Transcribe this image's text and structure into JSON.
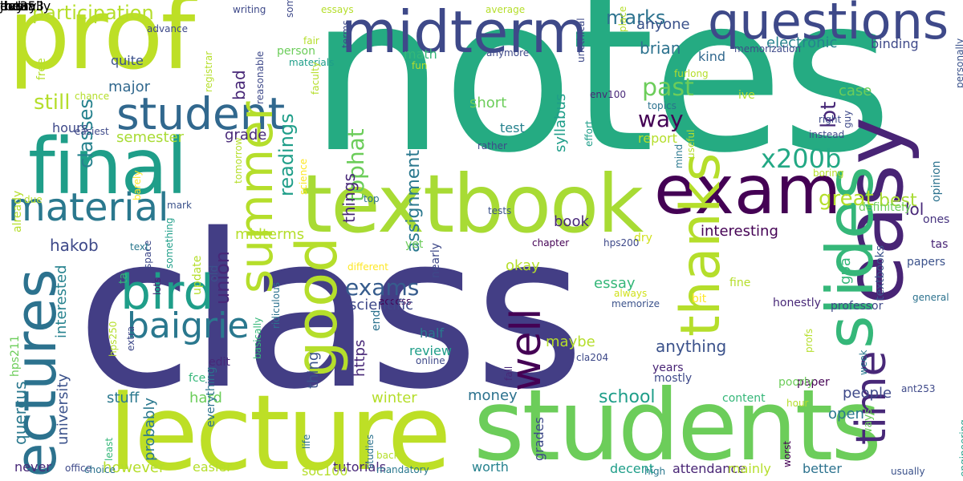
{
  "words": [
    {
      "text": "class",
      "rotated": false
    },
    {
      "text": "notes",
      "rotated": false
    },
    {
      "text": "prof",
      "rotated": false
    },
    {
      "text": "lecture",
      "rotated": false
    },
    {
      "text": "students",
      "rotated": false
    },
    {
      "text": "midterm",
      "rotated": false
    },
    {
      "text": "questions",
      "rotated": false
    },
    {
      "text": "final",
      "rotated": false
    },
    {
      "text": "textbook",
      "rotated": false
    },
    {
      "text": "exam",
      "rotated": false
    },
    {
      "text": "easy",
      "rotated": true
    },
    {
      "text": "slides",
      "rotated": true
    },
    {
      "text": "material",
      "rotated": false
    },
    {
      "text": "student",
      "rotated": false
    },
    {
      "text": "lectures",
      "rotated": true
    },
    {
      "text": "bird",
      "rotated": false
    },
    {
      "text": "good",
      "rotated": true
    },
    {
      "text": "thanks",
      "rotated": true
    },
    {
      "text": "well",
      "rotated": true
    },
    {
      "text": "summer",
      "rotated": true
    },
    {
      "text": "time",
      "rotated": true
    },
    {
      "text": "baigrie",
      "rotated": false
    },
    {
      "text": "exams",
      "rotated": false
    },
    {
      "text": "x200b",
      "rotated": false
    },
    {
      "text": "past",
      "rotated": false
    },
    {
      "text": "way",
      "rotated": false
    },
    {
      "text": "marks",
      "rotated": false
    },
    {
      "text": "great",
      "rotated": false
    },
    {
      "text": "best",
      "rotated": false
    },
    {
      "text": "lol",
      "rotated": false
    },
    {
      "text": "school",
      "rotated": false
    },
    {
      "text": "union",
      "rotated": true
    },
    {
      "text": "quercus",
      "rotated": true
    },
    {
      "text": "participation",
      "rotated": false
    },
    {
      "text": "anyone",
      "rotated": false
    },
    {
      "text": "brian",
      "rotated": false
    },
    {
      "text": "electronic",
      "rotated": false
    },
    {
      "text": "lot",
      "rotated": true
    },
    {
      "text": "binding",
      "rotated": false
    },
    {
      "text": "case",
      "rotated": false
    },
    {
      "text": "classes",
      "rotated": true
    },
    {
      "text": "still",
      "rotated": false
    },
    {
      "text": "quite",
      "rotated": false
    },
    {
      "text": "major",
      "rotated": false
    },
    {
      "text": "semester",
      "rotated": false
    },
    {
      "text": "hours",
      "rotated": false
    },
    {
      "text": "grade",
      "rotated": false
    },
    {
      "text": "readings",
      "rotated": true
    },
    {
      "text": "tophat",
      "rotated": true
    },
    {
      "text": "assignment",
      "rotated": true
    },
    {
      "text": "short",
      "rotated": false
    },
    {
      "text": "test",
      "rotated": false
    },
    {
      "text": "syllabus",
      "rotated": true
    },
    {
      "text": "book",
      "rotated": false
    },
    {
      "text": "report",
      "rotated": false
    },
    {
      "text": "kind",
      "rotated": false
    },
    {
      "text": "personally",
      "rotated": true
    },
    {
      "text": "opinion",
      "rotated": true
    },
    {
      "text": "definitely",
      "rotated": false
    },
    {
      "text": "ones",
      "rotated": false
    },
    {
      "text": "tas",
      "rotated": false
    },
    {
      "text": "papers",
      "rotated": false
    },
    {
      "text": "gpa",
      "rotated": true
    },
    {
      "text": "interesting",
      "rotated": false
    },
    {
      "text": "anything",
      "rotated": false
    },
    {
      "text": "people",
      "rotated": false
    },
    {
      "text": "open",
      "rotated": false
    },
    {
      "text": "ways",
      "rotated": true
    },
    {
      "text": "usually",
      "rotated": false
    },
    {
      "text": "worst",
      "rotated": true
    },
    {
      "text": "week",
      "rotated": true
    },
    {
      "text": "general",
      "rotated": false
    },
    {
      "text": "textbooks",
      "rotated": true
    },
    {
      "text": "engineering",
      "rotated": true
    },
    {
      "text": "ant253",
      "rotated": false
    },
    {
      "text": "dry",
      "rotated": false
    },
    {
      "text": "professor",
      "rotated": false
    },
    {
      "text": "fine",
      "rotated": false
    },
    {
      "text": "honestly",
      "rotated": false
    },
    {
      "text": "bit",
      "rotated": false
    },
    {
      "text": "paper",
      "rotated": false
    },
    {
      "text": "hour",
      "rotated": false
    },
    {
      "text": "content",
      "rotated": false
    },
    {
      "text": "mostly",
      "rotated": false
    },
    {
      "text": "high",
      "rotated": false
    },
    {
      "text": "attendance",
      "rotated": false
    },
    {
      "text": "better",
      "rotated": false
    },
    {
      "text": "mainly",
      "rotated": false
    },
    {
      "text": "decent",
      "rotated": false
    },
    {
      "text": "years",
      "rotated": false
    },
    {
      "text": "poorly",
      "rotated": false
    },
    {
      "text": "cla204",
      "rotated": false
    },
    {
      "text": "memorize",
      "rotated": false
    },
    {
      "text": "always",
      "rotated": false
    },
    {
      "text": "essay",
      "rotated": false
    },
    {
      "text": "maybe",
      "rotated": false
    },
    {
      "text": "okay",
      "rotated": false
    },
    {
      "text": "hps200",
      "rotated": false
    },
    {
      "text": "chapter",
      "rotated": false
    },
    {
      "text": "profs",
      "rotated": false
    },
    {
      "text": "tests",
      "rotated": false
    },
    {
      "text": "money",
      "rotated": false
    },
    {
      "text": "winter",
      "rotated": false
    },
    {
      "text": "fall",
      "rotated": true
    },
    {
      "text": "review",
      "rotated": false
    },
    {
      "text": "online",
      "rotated": false
    },
    {
      "text": "tutorials",
      "rotated": false
    },
    {
      "text": "grades",
      "rotated": true
    },
    {
      "text": "worth",
      "rotated": false
    },
    {
      "text": "back",
      "rotated": false
    },
    {
      "text": "mandatory",
      "rotated": false
    },
    {
      "text": "studies",
      "rotated": false
    },
    {
      "text": "soc100",
      "rotated": false
    },
    {
      "text": "half",
      "rotated": false
    },
    {
      "text": "access",
      "rotated": false
    },
    {
      "text": "nearly",
      "rotated": true
    },
    {
      "text": "different",
      "rotated": false
    },
    {
      "text": "https",
      "rotated": false
    },
    {
      "text": "scientific",
      "rotated": false
    },
    {
      "text": "end",
      "rotated": false
    },
    {
      "text": "yet",
      "rotated": false
    },
    {
      "text": "things",
      "rotated": true
    },
    {
      "text": "top",
      "rotated": false
    },
    {
      "text": "basically",
      "rotated": true
    },
    {
      "text": "ridiculous",
      "rotated": false
    },
    {
      "text": "hakob",
      "rotated": false
    },
    {
      "text": "midterms",
      "rotated": false
    },
    {
      "text": "bad",
      "rotated": false
    },
    {
      "text": "interested",
      "rotated": true
    },
    {
      "text": "university",
      "rotated": true
    },
    {
      "text": "stuff",
      "rotated": false
    },
    {
      "text": "hard",
      "rotated": false
    },
    {
      "text": "thing",
      "rotated": true
    },
    {
      "text": "everything",
      "rotated": true
    },
    {
      "text": "probably",
      "rotated": true
    },
    {
      "text": "however",
      "rotated": false
    },
    {
      "text": "easier",
      "rotated": false
    },
    {
      "text": "never",
      "rotated": false
    },
    {
      "text": "hps211",
      "rotated": false
    },
    {
      "text": "office",
      "rotated": false
    },
    {
      "text": "choice",
      "rotated": false
    },
    {
      "text": "least",
      "rotated": false
    },
    {
      "text": "life",
      "rotated": false
    },
    {
      "text": "already",
      "rotated": true
    },
    {
      "text": "free",
      "rotated": false
    },
    {
      "text": "due",
      "rotated": false
    },
    {
      "text": "space",
      "rotated": true
    },
    {
      "text": "something",
      "rotated": true
    },
    {
      "text": "hps250",
      "rotated": true
    },
    {
      "text": "extra",
      "rotated": true
    },
    {
      "text": "lots",
      "rotated": false
    },
    {
      "text": "fce",
      "rotated": false
    },
    {
      "text": "edit",
      "rotated": false
    },
    {
      "text": "update",
      "rotated": true
    },
    {
      "text": "old",
      "rotated": false
    },
    {
      "text": "ta",
      "rotated": true
    },
    {
      "text": "text",
      "rotated": false
    },
    {
      "text": "mark",
      "rotated": false
    },
    {
      "text": "barely",
      "rotated": true
    },
    {
      "text": "tomorrow",
      "rotated": true
    },
    {
      "text": "science",
      "rotated": false
    },
    {
      "text": "easiest",
      "rotated": false
    },
    {
      "text": "chance",
      "rotated": false
    },
    {
      "text": "advance",
      "rotated": false
    },
    {
      "text": "writing",
      "rotated": false
    },
    {
      "text": "someone",
      "rotated": true
    },
    {
      "text": "essays",
      "rotated": false
    },
    {
      "text": "average",
      "rotated": false
    },
    {
      "text": "place",
      "rotated": false
    },
    {
      "text": "fair",
      "rotated": false
    },
    {
      "text": "person",
      "rotated": false
    },
    {
      "text": "materials",
      "rotated": false
    },
    {
      "text": "reasonable",
      "rotated": false
    },
    {
      "text": "terms",
      "rotated": true
    },
    {
      "text": "math",
      "rotated": false
    },
    {
      "text": "anymore",
      "rotated": false
    },
    {
      "text": "fun",
      "rotated": false
    },
    {
      "text": "unethical",
      "rotated": true
    },
    {
      "text": "env100",
      "rotated": false
    },
    {
      "text": "furlong",
      "rotated": false
    },
    {
      "text": "memorization",
      "rotated": false
    },
    {
      "text": "topics",
      "rotated": false
    },
    {
      "text": "ive",
      "rotated": false
    },
    {
      "text": "effort",
      "rotated": false
    },
    {
      "text": "rather",
      "rotated": false
    },
    {
      "text": "faculty",
      "rotated": false
    },
    {
      "text": "registrar",
      "rotated": false
    },
    {
      "text": "right",
      "rotated": false
    },
    {
      "text": "guy",
      "rotated": true
    },
    {
      "text": "instead",
      "rotated": false
    },
    {
      "text": "useful",
      "rotated": true
    },
    {
      "text": "mind",
      "rotated": true
    },
    {
      "text": "boring",
      "rotated": false
    },
    {
      "text": "jhe353",
      "rotated": false
    },
    {
      "text": "day",
      "rotated": false
    },
    {
      "text": "even",
      "rotated": false
    },
    {
      "text": "actually",
      "rotated": false
    },
    {
      "text": "today",
      "rotated": false
    }
  ]
}
